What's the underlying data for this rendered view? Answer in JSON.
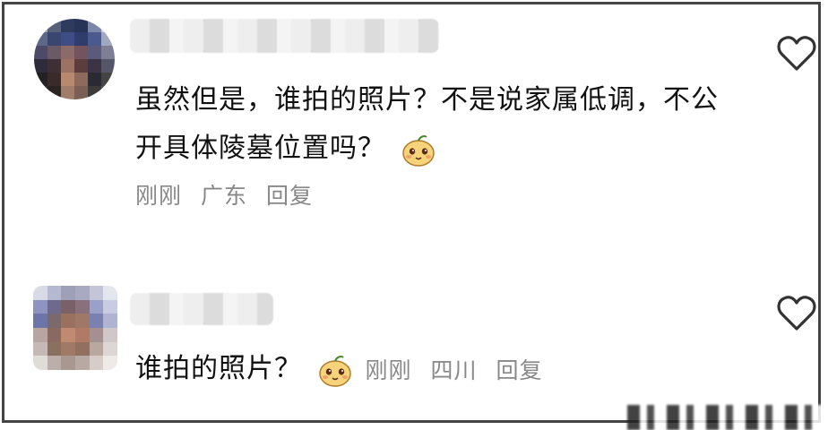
{
  "comments": [
    {
      "text": "虽然但是，谁拍的照片？不是说家属低调，不公开具体陵墓位置吗？",
      "time": "刚刚",
      "location": "广东",
      "reply_label": "回复",
      "emoji": "smiling-pear-emoji",
      "like_icon": "heart-outline-icon"
    },
    {
      "text": "谁拍的照片？",
      "time": "刚刚",
      "location": "四川",
      "reply_label": "回复",
      "emoji": "smiling-pear-emoji",
      "like_icon": "heart-outline-icon"
    }
  ],
  "colors": {
    "text": "#111111",
    "meta": "#888888",
    "border": "#444444",
    "heart_stroke": "#333333"
  }
}
